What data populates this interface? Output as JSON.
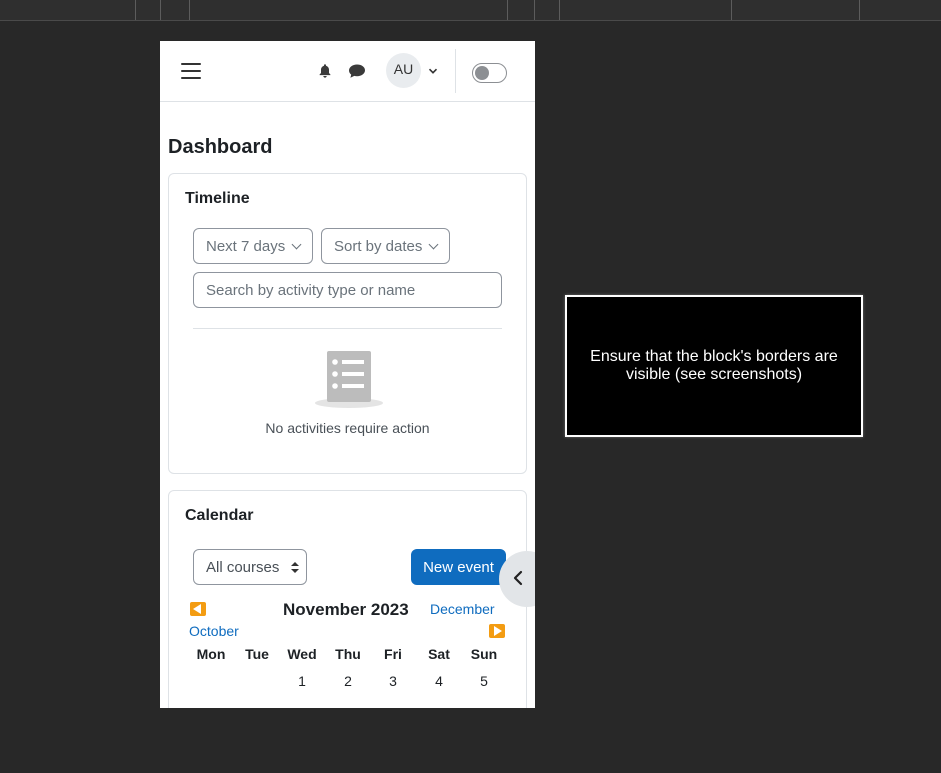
{
  "navbar": {
    "avatar_initials": "AU",
    "icons": [
      "menu-icon",
      "bell-icon",
      "chat-icon",
      "chevron-down-icon"
    ]
  },
  "page": {
    "title": "Dashboard"
  },
  "timeline": {
    "title": "Timeline",
    "filter_label": "Next 7 days",
    "sort_label": "Sort by dates",
    "search_placeholder": "Search by activity type or name",
    "empty_text": "No activities require action"
  },
  "calendar": {
    "title": "Calendar",
    "courses_select": "All courses",
    "new_event": "New event",
    "month": "November 2023",
    "prev_month": "October",
    "next_month": "December",
    "weekdays": [
      "Mon",
      "Tue",
      "Wed",
      "Thu",
      "Fri",
      "Sat",
      "Sun"
    ],
    "first_row_days": [
      "",
      "",
      "1",
      "2",
      "3",
      "4",
      "5"
    ]
  },
  "notice": {
    "text": "Ensure that the block's borders are visible (see screenshots)"
  },
  "colors": {
    "primary": "#0f6cbf",
    "nav_arrow": "#f39c12",
    "background": "#282828"
  }
}
